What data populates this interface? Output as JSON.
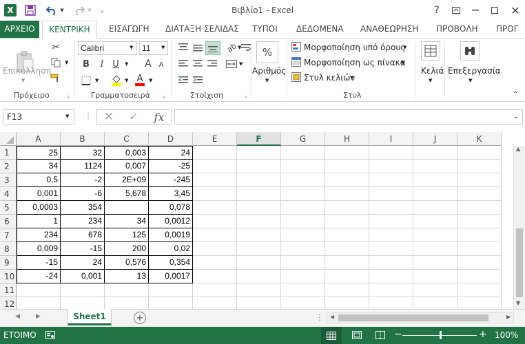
{
  "app": {
    "title": "Βιβλίο1 - Excel",
    "logo": "X",
    "help": "?"
  },
  "tabs": {
    "file": "ΑΡΧΕΙΟ",
    "items": [
      "ΚΕΝΤΡΙΚΗ",
      "ΕΙΣΑΓΩΓΗ",
      "ΔΙΑΤΑΞΗ ΣΕΛΙΔΑΣ",
      "ΤΥΠΟΙ",
      "ΔΕΔΟΜΕΝΑ",
      "ΑΝΑΘΕΩΡΗΣΗ",
      "ΠΡΟΒΟΛΗ",
      "ΠΡΟΓ"
    ]
  },
  "ribbon": {
    "clipboard": {
      "paste": "Επικόλληση",
      "label": "Πρόχειρο"
    },
    "font": {
      "name": "Calibri",
      "size": "11",
      "label": "Γραμματοσειρά",
      "bold": "B",
      "italic": "I",
      "underline": "U",
      "grow": "A",
      "shrink": "A",
      "color": "A"
    },
    "alignment": {
      "label": "Στοίχιση"
    },
    "number": {
      "label": "Αριθμός",
      "symbol": "%"
    },
    "styles": {
      "cond": "Μορφοποίηση υπό όρους",
      "table": "Μορφοποίηση ως πίνακα",
      "cell": "Στυλ κελιών",
      "label": "Στυλ"
    },
    "cells": {
      "label": "Κελιά"
    },
    "editing": {
      "label": "Επεξεργασία"
    }
  },
  "formula": {
    "namebox": "F13",
    "fx": "fx",
    "value": ""
  },
  "grid": {
    "columns": [
      "A",
      "B",
      "C",
      "D",
      "E",
      "F",
      "G",
      "H",
      "I",
      "J",
      "K"
    ],
    "rows": [
      "1",
      "2",
      "3",
      "4",
      "5",
      "6",
      "7",
      "8",
      "9",
      "10",
      "11",
      "12"
    ],
    "cells": [
      [
        "25",
        "32",
        "0,003",
        "24"
      ],
      [
        "34",
        "1124",
        "0,007",
        "-25"
      ],
      [
        "0,5",
        "-2",
        "2E+09",
        "-245"
      ],
      [
        "0,001",
        "-6",
        "5,678",
        "3,45"
      ],
      [
        "0,0003",
        "354",
        "",
        "0,078"
      ],
      [
        "1",
        "234",
        "34",
        "0,0012"
      ],
      [
        "234",
        "678",
        "125",
        "0,0019"
      ],
      [
        "0,009",
        "-15",
        "200",
        "0,02"
      ],
      [
        "-15",
        "24",
        "0,576",
        "0,354"
      ],
      [
        "-24",
        "0,001",
        "13",
        "0,0017"
      ]
    ]
  },
  "sheets": {
    "active": "Sheet1",
    "add": "+"
  },
  "status": {
    "ready": "ΕΤΟΙΜΟ",
    "zoom": "100%",
    "minus": "−",
    "plus": "+"
  },
  "colors": {
    "accent": "#217346",
    "selected_col": "#217346"
  }
}
